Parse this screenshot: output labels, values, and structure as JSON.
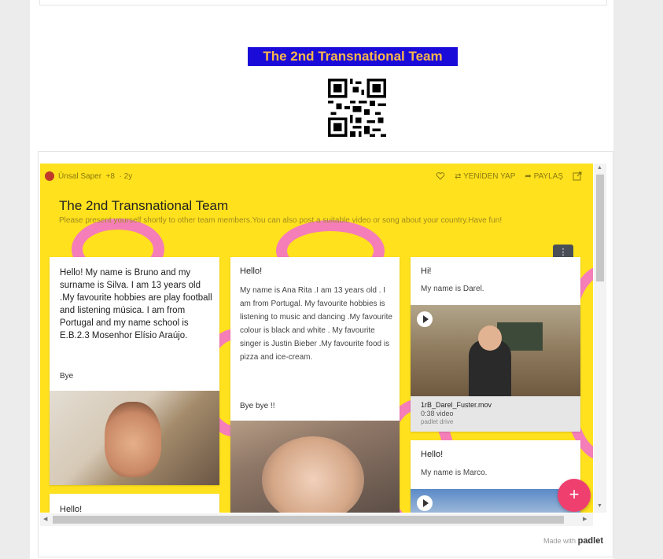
{
  "header": {
    "banner_title": "The 2nd Transnational Team"
  },
  "padlet": {
    "author": "Ünsal Saper",
    "contributors": "+8",
    "age": "2y",
    "actions": {
      "remake": "YENİDEN YAP",
      "share": "PAYLAŞ"
    },
    "title": "The 2nd Transnational Team",
    "description": "Please present yourself shortly to other team members.You can also post a suitable video or song about your country.Have fun!",
    "menu_icon": "vertical-dots",
    "add_label": "+",
    "posts": [
      {
        "text": "Hello! My name is Bruno and my surname is Silva. I am 13 years old .My favourite hobbies are play football and listening música. I am from Portugal and my name school is E.B.2.3 Mosenhor Elísio Araújo.",
        "footer": "Bye"
      },
      {
        "title": "Hello!",
        "text": "My name is Ana Rita .I am 13 years old . I am from Portugal. My favourite hobbies is listening to music and dancing .My favourite colour is black and white . My favourite singer is Justin Bieber .My favourite food is pizza and ice-cream.",
        "footer": "Bye bye !!"
      },
      {
        "title": "Hi!",
        "text": "My name is Darel.",
        "attachment": {
          "filename": "1rB_Darel_Fuster.mov",
          "duration": "0:38 video",
          "source": "padlet drive"
        }
      },
      {
        "title": "Hello!",
        "text": "My name is Marco."
      },
      {
        "title": "Hello!"
      }
    ],
    "made_with": "Made with",
    "brand": "padlet"
  },
  "colors": {
    "board_bg": "#ffe11d",
    "banner_bg": "#1a0bd8",
    "banner_text": "#fbb84a",
    "fab": "#ee3f6f"
  }
}
